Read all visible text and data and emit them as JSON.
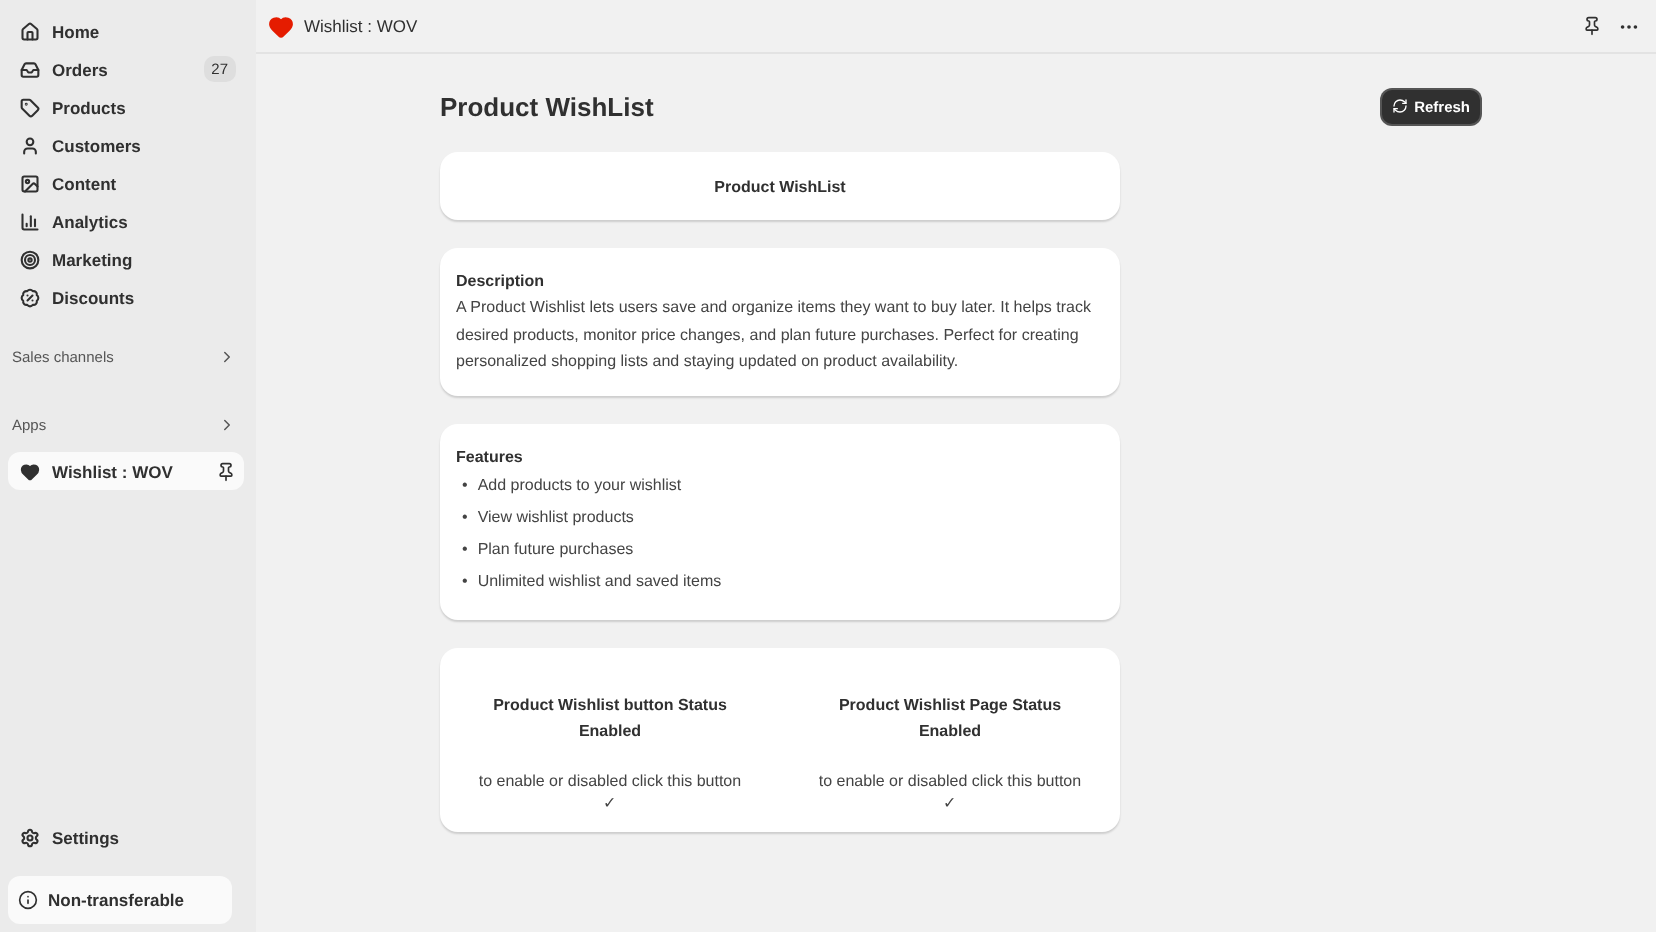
{
  "sidebar": {
    "items": [
      {
        "label": "Home",
        "selected": false
      },
      {
        "label": "Orders",
        "selected": false,
        "count": "27"
      },
      {
        "label": "Products",
        "selected": false
      },
      {
        "label": "Customers",
        "selected": false
      },
      {
        "label": "Content",
        "selected": false
      },
      {
        "label": "Analytics",
        "selected": false
      },
      {
        "label": "Marketing",
        "selected": false
      },
      {
        "label": "Discounts",
        "selected": false
      }
    ],
    "sections": [
      {
        "label": "Sales channels"
      },
      {
        "label": "Apps"
      }
    ],
    "apps": [
      {
        "label": "Wishlist : WOV",
        "selected": true
      }
    ],
    "settings": "Settings",
    "footer": "Non-transferable"
  },
  "topbar": {
    "title": "Wishlist : WOV"
  },
  "page": {
    "title": "Product WishList",
    "refresh": "Refresh",
    "banner": "Product WishList",
    "description": {
      "heading": "Description",
      "text": "A Product Wishlist lets users save and organize items they want to buy later. It helps track desired products, monitor price changes, and plan future purchases. Perfect for creating personalized shopping lists and staying updated on product availability."
    },
    "features": {
      "heading": "Features",
      "bullet": "•",
      "items": [
        "Add products to your wishlist",
        "View wishlist products",
        "Plan future purchases",
        "Unlimited wishlist and saved items"
      ]
    },
    "statuses": [
      {
        "title": "Product Wishlist button Status",
        "status": "Enabled",
        "hint": "to enable or disabled click this button",
        "mark": "✓"
      },
      {
        "title": "Product Wishlist Page Status",
        "status": "Enabled",
        "hint": "to enable or disabled click this button",
        "mark": "✓"
      }
    ]
  }
}
